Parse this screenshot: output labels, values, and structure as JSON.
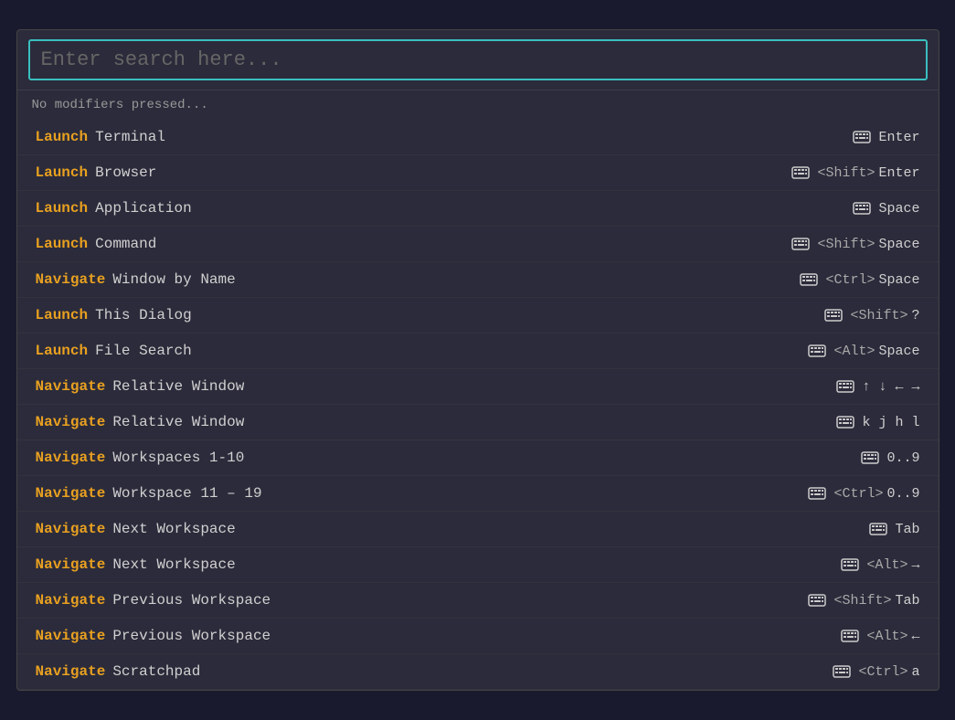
{
  "search": {
    "placeholder": "Enter search here..."
  },
  "modifier_status": "No modifiers pressed...",
  "items": [
    {
      "action": "Launch",
      "target": "Terminal",
      "shortcut_mod": "",
      "shortcut_key": "Enter"
    },
    {
      "action": "Launch",
      "target": "Browser",
      "shortcut_mod": "<Shift>",
      "shortcut_key": "Enter"
    },
    {
      "action": "Launch",
      "target": "Application",
      "shortcut_mod": "",
      "shortcut_key": "Space"
    },
    {
      "action": "Launch",
      "target": "Command",
      "shortcut_mod": "<Shift>",
      "shortcut_key": "Space"
    },
    {
      "action": "Navigate",
      "target": "Window by Name",
      "shortcut_mod": "<Ctrl>",
      "shortcut_key": "Space"
    },
    {
      "action": "Launch",
      "target": "This Dialog",
      "shortcut_mod": "<Shift>",
      "shortcut_key": "?"
    },
    {
      "action": "Launch",
      "target": "File Search",
      "shortcut_mod": "<Alt>",
      "shortcut_key": "Space"
    },
    {
      "action": "Navigate",
      "target": "Relative Window",
      "shortcut_mod": "",
      "shortcut_key": "↑ ↓ ← →"
    },
    {
      "action": "Navigate",
      "target": "Relative Window",
      "shortcut_mod": "",
      "shortcut_key": "k j h l"
    },
    {
      "action": "Navigate",
      "target": "Workspaces 1-10",
      "shortcut_mod": "",
      "shortcut_key": "0..9"
    },
    {
      "action": "Navigate",
      "target": "Workspace 11 – 19",
      "shortcut_mod": "<Ctrl>",
      "shortcut_key": "0..9"
    },
    {
      "action": "Navigate",
      "target": "Next Workspace",
      "shortcut_mod": "",
      "shortcut_key": "Tab"
    },
    {
      "action": "Navigate",
      "target": "Next Workspace",
      "shortcut_mod": "<Alt>",
      "shortcut_key": "→"
    },
    {
      "action": "Navigate",
      "target": "Previous Workspace",
      "shortcut_mod": "<Shift>",
      "shortcut_key": "Tab"
    },
    {
      "action": "Navigate",
      "target": "Previous Workspace",
      "shortcut_mod": "<Alt>",
      "shortcut_key": "←"
    },
    {
      "action": "Navigate",
      "target": "Scratchpad",
      "shortcut_mod": "<Ctrl>",
      "shortcut_key": "a"
    }
  ]
}
